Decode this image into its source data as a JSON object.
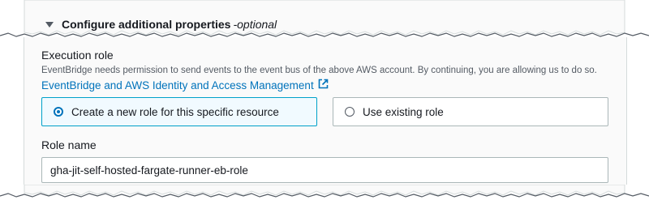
{
  "section": {
    "title": "Configure additional properties",
    "optional_label": "-optional"
  },
  "execution_role": {
    "label": "Execution role",
    "description": "EventBridge needs permission to send events to the event bus of the above AWS account. By continuing, you are allowing us to do so.",
    "link_text": "EventBridge and AWS Identity and Access Management",
    "options": [
      {
        "label": "Create a new role for this specific resource",
        "selected": true
      },
      {
        "label": "Use existing role",
        "selected": false
      }
    ]
  },
  "role_name": {
    "label": "Role name",
    "value": "gha-jit-self-hosted-fargate-runner-eb-role"
  },
  "colors": {
    "accent": "#0073bb",
    "selected_tile_bg": "#f1faff",
    "selected_tile_border": "#00a1c9",
    "panel_bg": "#fafafa"
  },
  "icons": [
    "caret-down-icon",
    "external-link-icon"
  ]
}
